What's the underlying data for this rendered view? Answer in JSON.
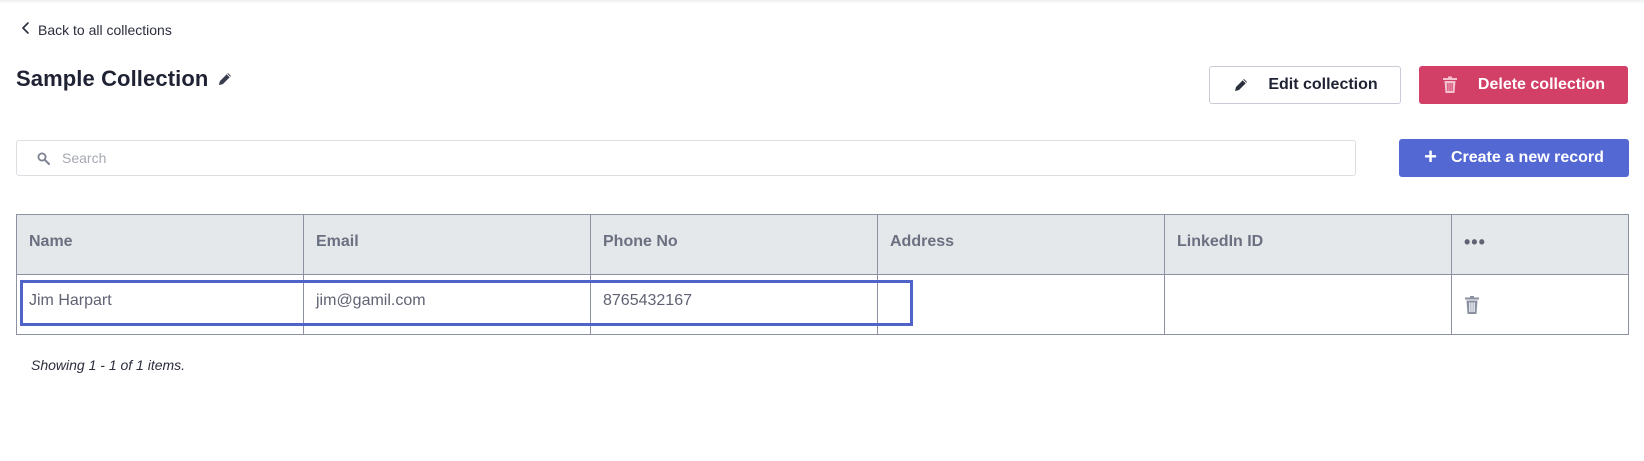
{
  "nav": {
    "back_label": "Back to all collections"
  },
  "header": {
    "title": "Sample Collection",
    "edit_label": "Edit collection",
    "delete_label": "Delete collection"
  },
  "search": {
    "placeholder": "Search",
    "value": ""
  },
  "actions": {
    "create_label": "Create a new record",
    "create_icon": "+"
  },
  "table": {
    "columns": [
      "Name",
      "Email",
      "Phone No",
      "Address",
      "LinkedIn ID"
    ],
    "menu_icon": "•••",
    "rows": [
      {
        "name": "Jim Harpart",
        "email": "jim@gamil.com",
        "phone": "8765432167",
        "address": "",
        "linkedin": ""
      }
    ]
  },
  "footer": {
    "summary": "Showing 1 - 1 of 1 items."
  },
  "colors": {
    "accent": "#5468d4",
    "danger": "#d23f67",
    "header_bg": "#e5e8eb",
    "highlight": "#5063c9"
  },
  "icons": {
    "back": "chevron-left-icon",
    "title_edit": "pencil-icon",
    "edit": "pencil-icon",
    "delete": "trash-icon",
    "search": "search-icon",
    "create": "plus-icon",
    "menu": "more-horizontal-icon",
    "row_delete": "trash-icon"
  }
}
